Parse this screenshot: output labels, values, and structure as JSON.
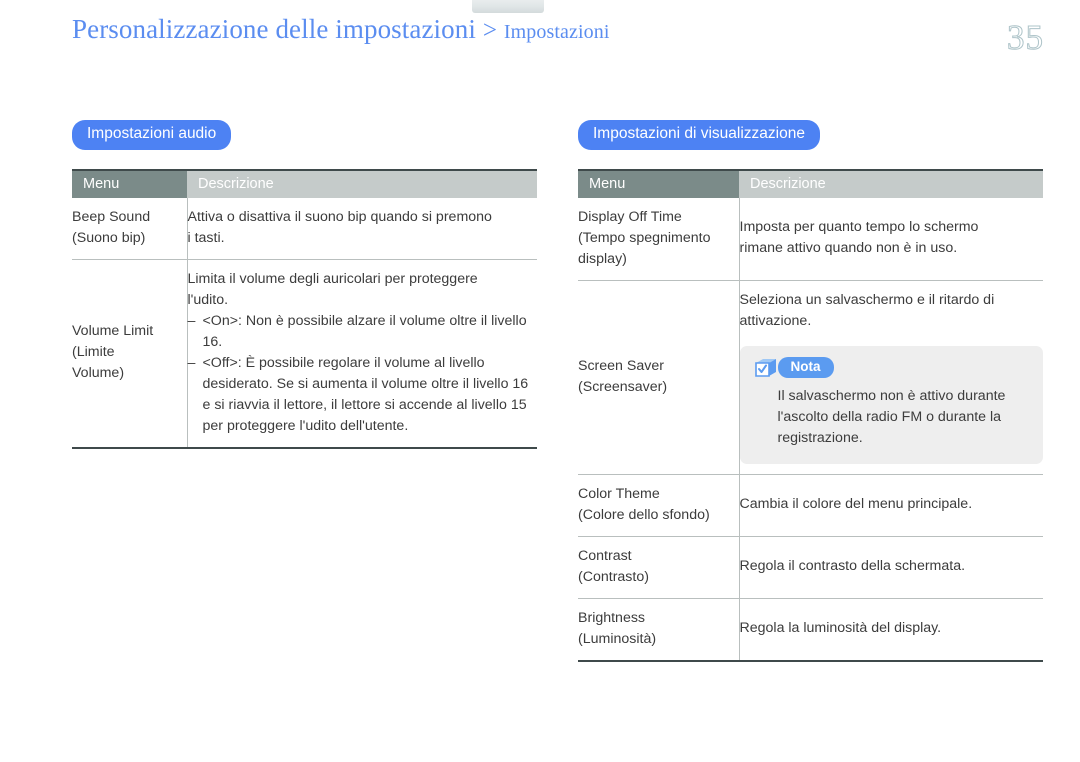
{
  "header": {
    "title_main": "Personalizzazione delle impostazioni",
    "separator": ">",
    "title_sub": "Impostazioni",
    "page_number": "35"
  },
  "colors": {
    "link_blue": "#4d90e8",
    "pill_blue": "#4d82f3",
    "note_blue": "#5b9bf0",
    "header_menu_bg": "#7b8b89",
    "header_desc_bg": "#c5cbca",
    "note_bg": "#eeeeee",
    "text": "#3c3c3c"
  },
  "left_section": {
    "pill_label": "Impostazioni audio",
    "columns": [
      "Menu",
      "Descrizione"
    ],
    "rows": [
      {
        "menu_en": "Beep Sound",
        "menu_it": "(Suono bip)",
        "desc_lines": [
          "Attiva o disattiva il suono bip quando si premono",
          "i tasti."
        ],
        "desc_bullets": []
      },
      {
        "menu_en": "Volume Limit",
        "menu_it": "(Limite",
        "menu_it2": "Volume)",
        "desc_lines": [
          "Limita il volume degli auricolari per proteggere",
          "l'udito."
        ],
        "desc_bullets": [
          "<On>: Non è possibile alzare il volume oltre il livello 16.",
          "<Off>: È possibile regolare il volume al livello desiderato. Se si aumenta il volume oltre il livello 16 e si riavvia il lettore, il lettore si accende al livello 15 per proteggere l'udito dell'utente."
        ]
      }
    ]
  },
  "right_section": {
    "pill_label": "Impostazioni di visualizzazione",
    "columns": [
      "Menu",
      "Descrizione"
    ],
    "rows": [
      {
        "menu_en": "Display Off Time",
        "menu_it": "(Tempo spegnimento",
        "menu_it2": "display)",
        "desc_lines": [
          "Imposta per quanto tempo lo schermo",
          "rimane attivo quando non è in uso."
        ]
      },
      {
        "menu_en": "Screen Saver",
        "menu_it": "(Screensaver)",
        "desc_lines": [
          "Seleziona un salvaschermo e il ritardo di",
          "attivazione."
        ],
        "note": {
          "icon": "note-cube-check-icon",
          "label": "Nota",
          "lines": [
            "Il salvaschermo non è attivo durante",
            "l'ascolto della radio FM o durante la",
            "registrazione."
          ]
        }
      },
      {
        "menu_en": "Color Theme",
        "menu_it": "(Colore dello sfondo)",
        "desc_lines": [
          "Cambia il colore del menu principale."
        ]
      },
      {
        "menu_en": "Contrast",
        "menu_it": "(Contrasto)",
        "desc_lines": [
          "Regola il contrasto della schermata."
        ]
      },
      {
        "menu_en": "Brightness",
        "menu_it": "(Luminosità)",
        "desc_lines": [
          "Regola la luminosità del display."
        ]
      }
    ]
  }
}
